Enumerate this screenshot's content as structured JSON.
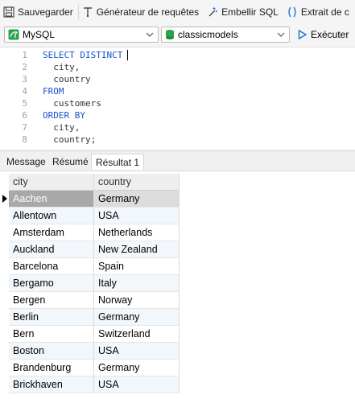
{
  "toolbar": {
    "save": "Sauvegarder",
    "query_builder": "Générateur de requêtes",
    "beautify": "Embellir SQL",
    "extract": "Extrait de c"
  },
  "connection": {
    "type": "MySQL",
    "database": "classicmodels",
    "run_label": "Exécuter"
  },
  "editor": {
    "lines": [
      {
        "n": "1",
        "text": "SELECT DISTINCT"
      },
      {
        "n": "2",
        "text": "  city,"
      },
      {
        "n": "3",
        "text": "  country"
      },
      {
        "n": "4",
        "text": "FROM"
      },
      {
        "n": "5",
        "text": "  customers"
      },
      {
        "n": "6",
        "text": "ORDER BY"
      },
      {
        "n": "7",
        "text": "  city,"
      },
      {
        "n": "8",
        "text": "  country;"
      }
    ]
  },
  "tabs": [
    "Message",
    "Résumé",
    "Résultat 1"
  ],
  "active_tab": "Résultat 1",
  "results": {
    "columns": [
      "city",
      "country"
    ],
    "rows": [
      [
        "Aachen",
        "Germany"
      ],
      [
        "Allentown",
        "USA"
      ],
      [
        "Amsterdam",
        "Netherlands"
      ],
      [
        "Auckland",
        "New Zealand"
      ],
      [
        "Barcelona",
        "Spain"
      ],
      [
        "Bergamo",
        "Italy"
      ],
      [
        "Bergen",
        "Norway"
      ],
      [
        "Berlin",
        "Germany"
      ],
      [
        "Bern",
        "Switzerland"
      ],
      [
        "Boston",
        "USA"
      ],
      [
        "Brandenburg",
        "Germany"
      ],
      [
        "Brickhaven",
        "USA"
      ]
    ]
  },
  "colors": {
    "keyword": "#1a52c9",
    "accent": "#1f6fd6",
    "db_green": "#2aa54a"
  }
}
